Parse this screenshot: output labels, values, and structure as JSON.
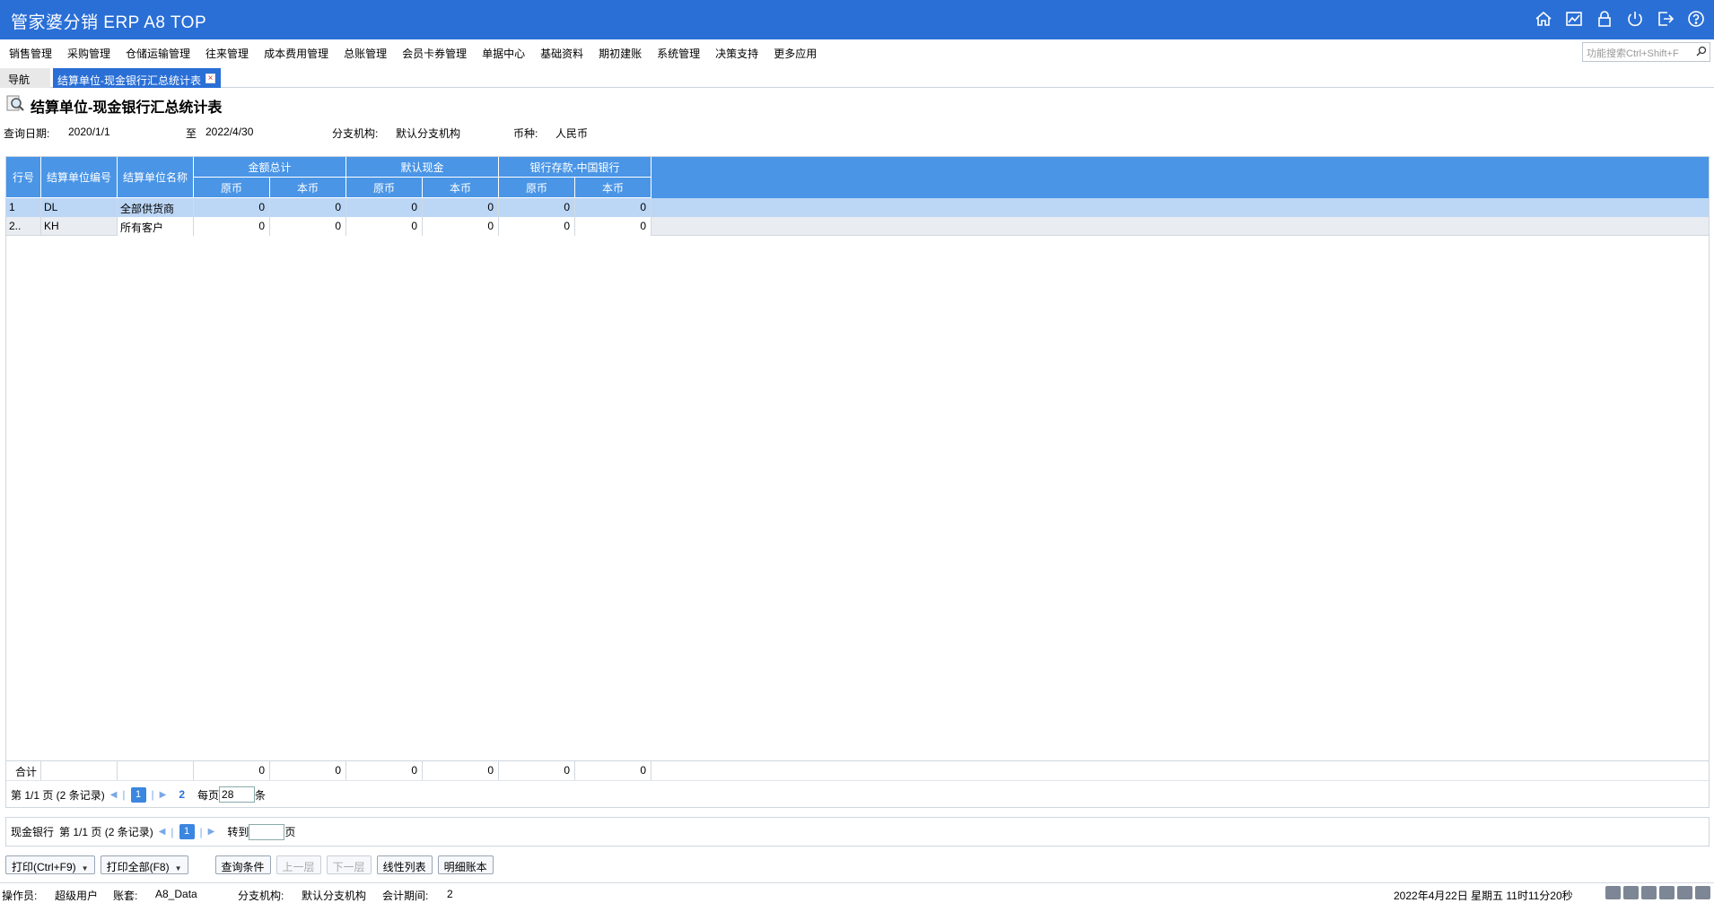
{
  "app": {
    "title": "管家婆分销 ERP A8 TOP"
  },
  "menu": [
    "销售管理",
    "采购管理",
    "仓储运输管理",
    "往来管理",
    "成本费用管理",
    "总账管理",
    "会员卡券管理",
    "单据中心",
    "基础资料",
    "期初建账",
    "系统管理",
    "决策支持",
    "更多应用"
  ],
  "search": {
    "placeholder": "功能搜索Ctrl+Shift+F"
  },
  "tabs": {
    "nav": "导航",
    "active": "结算单位-现金银行汇总统计表"
  },
  "page": {
    "title": "结算单位-现金银行汇总统计表"
  },
  "filters": {
    "date_label": "查询日期:",
    "date_from": "2020/1/1",
    "to_label": "至",
    "date_to": "2022/4/30",
    "branch_label": "分支机构:",
    "branch": "默认分支机构",
    "currency_label": "币种:",
    "currency": "人民币"
  },
  "grid": {
    "headers": {
      "row_no": "行号",
      "code": "结算单位编号",
      "name": "结算单位名称",
      "groups": [
        "金额总计",
        "默认现金",
        "银行存款-中国银行"
      ],
      "sub": [
        "原币",
        "本币",
        "原币",
        "本币",
        "原币",
        "本币"
      ]
    },
    "rows": [
      {
        "no": "1",
        "code": "DL",
        "name": "全部供货商",
        "v": [
          "0",
          "0",
          "0",
          "0",
          "0",
          "0"
        ]
      },
      {
        "no": "2..",
        "code": "KH",
        "name": "所有客户",
        "v": [
          "0",
          "0",
          "0",
          "0",
          "0",
          "0"
        ]
      }
    ],
    "total": {
      "label": "合计",
      "v": [
        "0",
        "0",
        "0",
        "0",
        "0",
        "0"
      ]
    },
    "pager": {
      "page_text": "第 1/1 页 (2 条记录)",
      "current": "1",
      "jump": "2",
      "per_page_label": "每页",
      "per_page": "28",
      "unit": "条"
    }
  },
  "subgrid": {
    "label": "现金银行",
    "page_text": "第 1/1 页 (2 条记录)",
    "current": "1",
    "goto_label": "转到",
    "page_unit": "页"
  },
  "buttons": {
    "print": "打印(Ctrl+F9)",
    "print_all": "打印全部(F8)",
    "query": "查询条件",
    "up": "上一层",
    "down": "下一层",
    "linear": "线性列表",
    "detail": "明细账本"
  },
  "status": {
    "operator_label": "操作员:",
    "operator": "超级用户",
    "account_label": "账套:",
    "account": "A8_Data",
    "branch_label": "分支机构:",
    "branch": "默认分支机构",
    "period_label": "会计期间:",
    "period": "2",
    "datetime": "2022年4月22日  星期五  11时11分20秒"
  }
}
